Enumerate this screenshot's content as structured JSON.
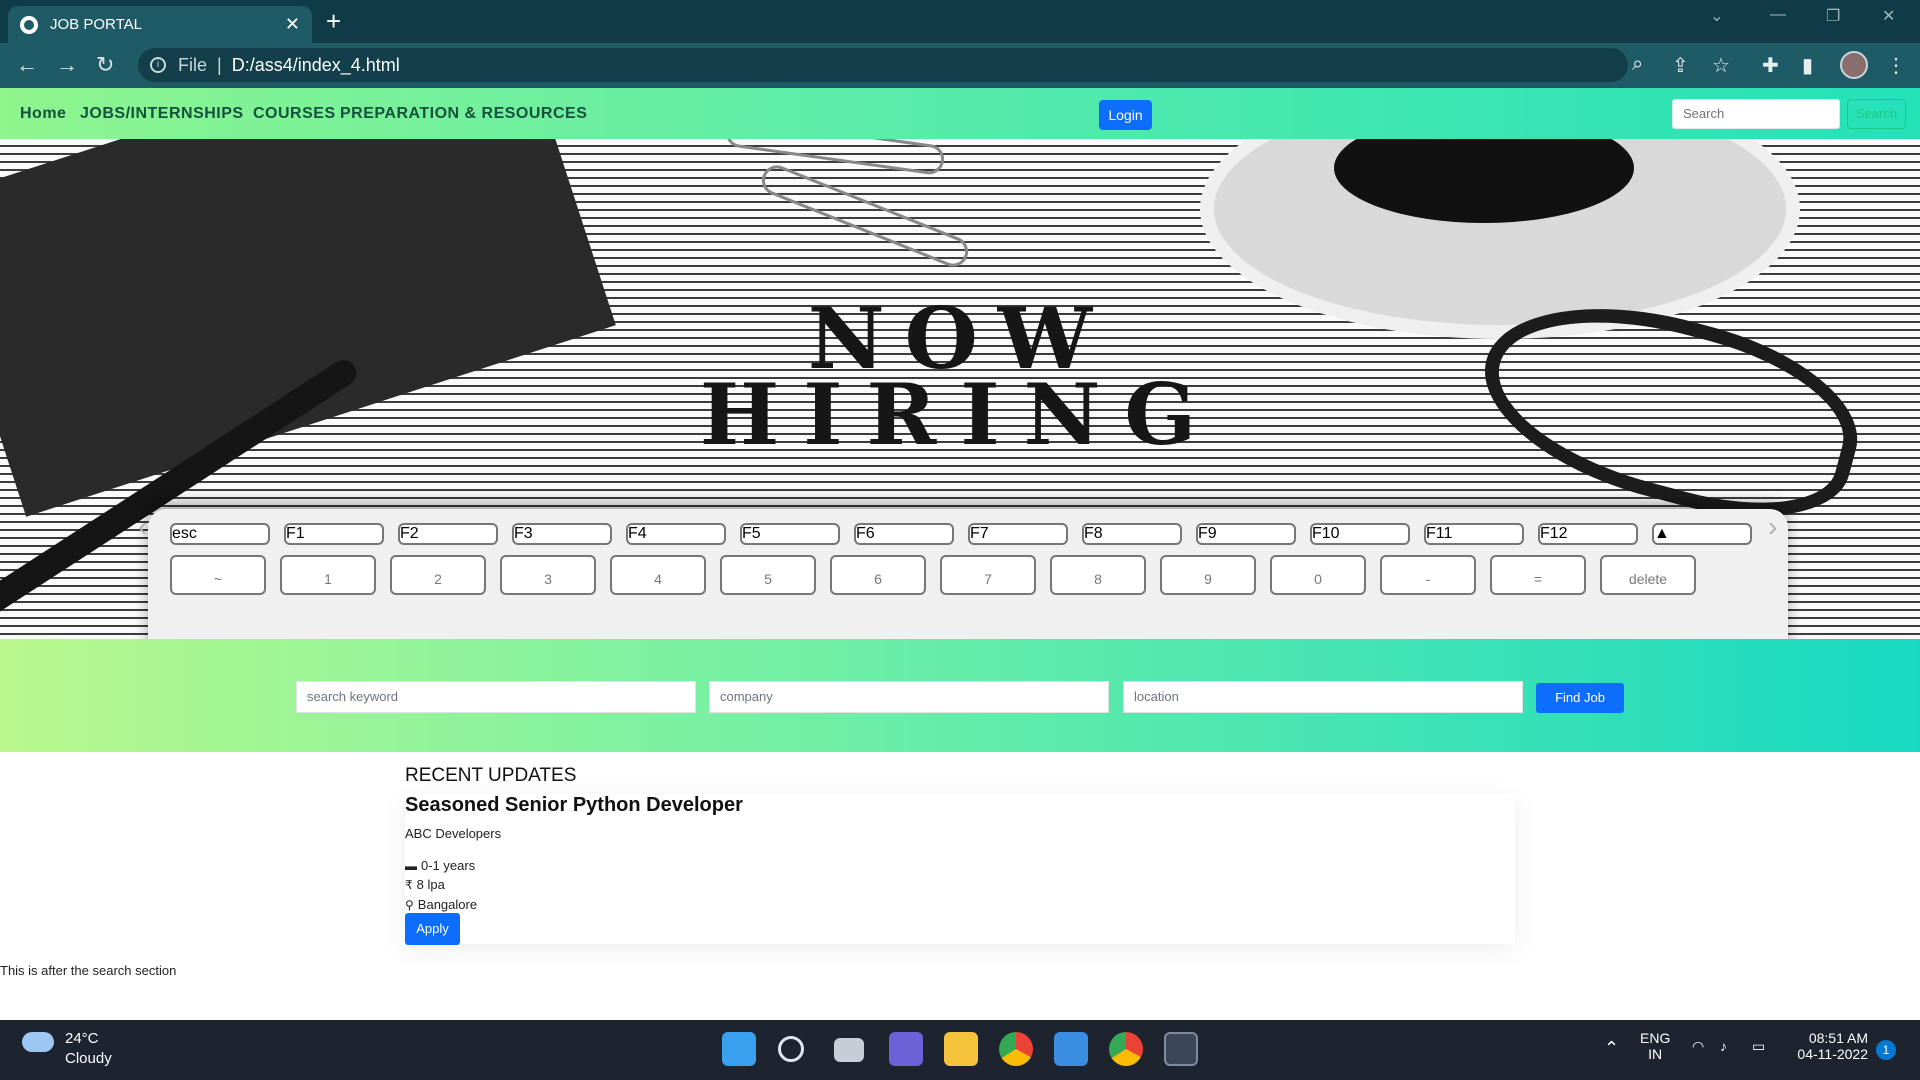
{
  "browser": {
    "tab_title": "JOB PORTAL",
    "tab_close": "✕",
    "new_tab": "+",
    "address_file": "File",
    "address_sep": "|",
    "address_url": "D:/ass4/index_4.html"
  },
  "navbar": {
    "links": [
      "Home",
      "JOBS/INTERNSHIPS",
      "COURSES",
      "PREPARATION & RESOURCES"
    ],
    "login_label": "Login",
    "search_placeholder": "Search",
    "search_button": "Search"
  },
  "hero": {
    "line1": "NOW",
    "line2": "HIRING",
    "row1_keys": [
      "esc",
      "F1",
      "F2",
      "F3",
      "F4",
      "F5",
      "F6",
      "F7",
      "F8",
      "F9",
      "F10",
      "F11",
      "F12",
      "▲"
    ],
    "row2_keys": [
      "~",
      "1",
      "2",
      "3",
      "4",
      "5",
      "6",
      "7",
      "8",
      "9",
      "0",
      "-",
      "=",
      "delete"
    ]
  },
  "search": {
    "keyword_placeholder": "search keyword",
    "company_placeholder": "company",
    "location_placeholder": "location",
    "button_label": "Find Job"
  },
  "updates": {
    "heading": "RECENT UPDATES",
    "job": {
      "title": "Seasoned Senior Python Developer",
      "company": "ABC Developers",
      "experience": "0-1 years",
      "salary": "8 lpa",
      "location": "Bangalore",
      "apply_label": "Apply",
      "rupee": "₹"
    }
  },
  "after_text": "This is after the search section",
  "taskbar": {
    "temperature": "24°C",
    "weather": "Cloudy",
    "lang": "ENG",
    "region": "IN",
    "time": "08:51 AM",
    "date": "04-11-2022",
    "notifications": "1"
  }
}
